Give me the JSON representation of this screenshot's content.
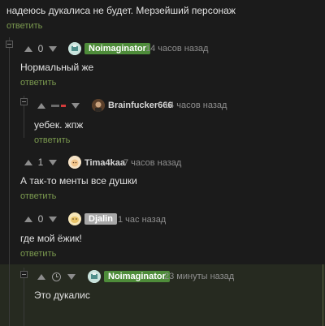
{
  "colors": {
    "background": "#1b1b1b",
    "text": "#e2e2e2",
    "reply_link": "#7b9a4f",
    "author_badge": "#4e8c3a",
    "user_badge": "#a7a7a7",
    "highlight": "#262a20",
    "minus_red": "#d43b3b"
  },
  "comments": [
    {
      "text": "надеюсь дукалиса не будет. Мерзейший персонаж",
      "reply": "ответить"
    },
    {
      "score": "0",
      "author": "Noimaginator",
      "author_style": "badge-green",
      "time": "14 часов назад",
      "text": "Нормальный же",
      "reply": "ответить"
    },
    {
      "score_icon": "minus-bar-icon",
      "author": "Brainfucker666",
      "time": "14 часов назад",
      "text": "уебек. жпж",
      "reply": "ответить"
    },
    {
      "score": "1",
      "author": "Tima4kaa",
      "time": "7 часов назад",
      "text": "А так-то менты все душки",
      "reply": "ответить"
    },
    {
      "score": "0",
      "author": "Djalin",
      "author_style": "badge-gray",
      "time": "1 час назад",
      "text": "где мой ёжик!",
      "reply": "ответить"
    },
    {
      "score_icon": "clock-icon",
      "author": "Noimaginator",
      "author_style": "badge-green",
      "time": "23 минуты назад",
      "text": "Это дукалис"
    }
  ]
}
